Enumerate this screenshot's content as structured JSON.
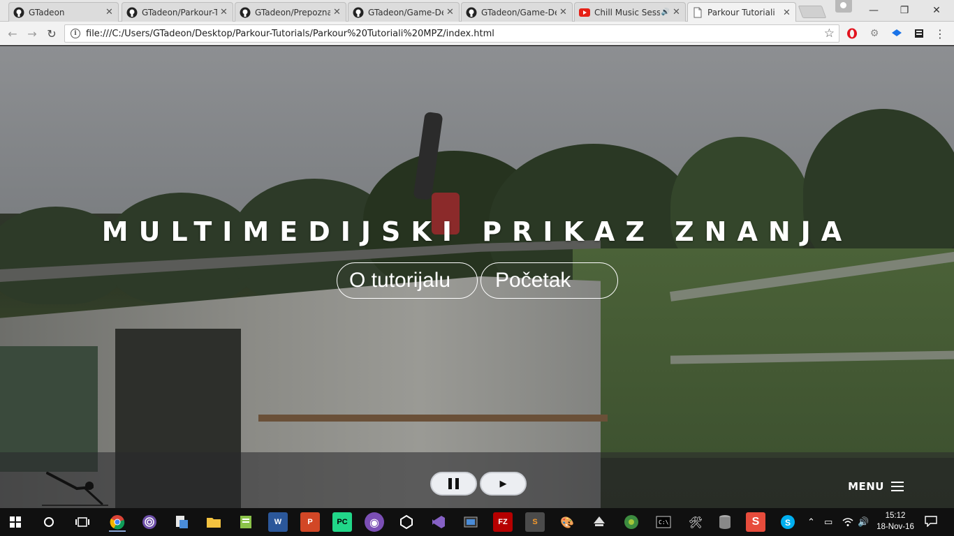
{
  "browser": {
    "tabs": [
      {
        "title": "GTadeon",
        "icon": "github-icon",
        "active": false
      },
      {
        "title": "GTadeon/Parkour-T",
        "icon": "github-icon",
        "active": false
      },
      {
        "title": "GTadeon/Prepozna",
        "icon": "github-icon",
        "active": false
      },
      {
        "title": "GTadeon/Game-De",
        "icon": "github-icon",
        "active": false
      },
      {
        "title": "GTadeon/Game-De",
        "icon": "github-icon",
        "active": false
      },
      {
        "title": "Chill Music Sess",
        "icon": "youtube-icon",
        "active": false,
        "audio": true
      },
      {
        "title": "Parkour Tutoriali",
        "icon": "page-icon",
        "active": true
      }
    ],
    "url": "file:///C:/Users/GTadeon/Desktop/Parkour-Tutorials/Parkour%20Tutoriali%20MPZ/index.html"
  },
  "page": {
    "hero_title": "MULTIMEDIJSKI PRIKAZ ZNANJA",
    "buttons": {
      "about": "O tutorijalu",
      "start": "Početak"
    },
    "menu_label": "MENU",
    "video_controls": {
      "pause_icon": "pause-icon",
      "play_symbol": "▶"
    }
  },
  "taskbar": {
    "time": "15:12",
    "date": "18-Nov-16",
    "apps": [
      "chrome-icon",
      "tor-icon",
      "file-explorer-icon",
      "folder-icon",
      "notepad-icon",
      "word-icon",
      "powerpoint-icon",
      "pycharm-icon",
      "app-icon",
      "unity-icon",
      "visual-studio-icon",
      "movie-maker-icon",
      "filezilla-icon",
      "sublime-icon",
      "paint-icon",
      "inkscape-icon",
      "android-studio-icon",
      "terminal-icon",
      "tools-icon",
      "database-icon",
      "snippet-icon",
      "skype-icon"
    ]
  },
  "colors": {
    "overlay_bar": "#28282c",
    "pill_border": "#ffffff",
    "taskbar": "#101010"
  }
}
